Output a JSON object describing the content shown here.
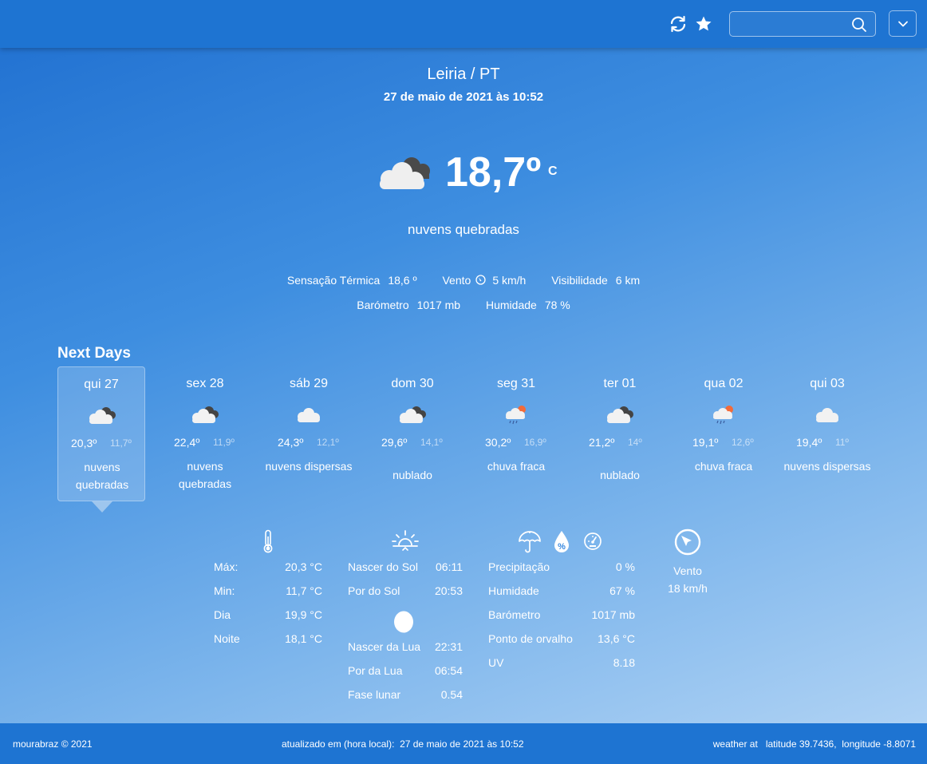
{
  "header": {
    "refresh_icon": "refresh-icon",
    "favorite_icon": "star-icon",
    "search": {
      "placeholder": "",
      "value": ""
    },
    "dropdown_icon": "chevron-down-icon"
  },
  "current": {
    "city": "Leiria / PT",
    "datetime": "27 de maio de 2021 às 10:52",
    "icon": "broken-clouds-icon",
    "temperature": "18,7º",
    "unit": "C",
    "condition": "nuvens quebradas",
    "stats": {
      "feels_like_label": "Sensação Térmica",
      "feels_like_value": "18,6 º",
      "wind_label": "Vento",
      "wind_value": "5 km/h",
      "visibility_label": "Visibilidade",
      "visibility_value": "6 km",
      "barometer_label": "Barómetro",
      "barometer_value": "1017 mb",
      "humidity_label": "Humidade",
      "humidity_value": "78 %"
    }
  },
  "next_days": {
    "title": "Next Days",
    "days": [
      {
        "name": "qui 27",
        "max": "20,3º",
        "min": "11,7º",
        "desc": "nuvens quebradas",
        "icon": "broken-clouds-icon"
      },
      {
        "name": "sex 28",
        "max": "22,4º",
        "min": "11,9º",
        "desc": "nuvens quebradas",
        "icon": "broken-clouds-icon"
      },
      {
        "name": "sáb 29",
        "max": "24,3º",
        "min": "12,1º",
        "desc": "nuvens dispersas",
        "icon": "scattered-clouds-icon"
      },
      {
        "name": "dom 30",
        "max": "29,6º",
        "min": "14,1º",
        "desc": "nublado",
        "icon": "overcast-clouds-icon"
      },
      {
        "name": "seg 31",
        "max": "30,2º",
        "min": "16,9º",
        "desc": "chuva fraca",
        "icon": "light-rain-icon"
      },
      {
        "name": "ter 01",
        "max": "21,2º",
        "min": "14º",
        "desc": "nublado",
        "icon": "overcast-clouds-icon"
      },
      {
        "name": "qua 02",
        "max": "19,1º",
        "min": "12,6º",
        "desc": "chuva fraca",
        "icon": "light-rain-icon"
      },
      {
        "name": "qui 03",
        "max": "19,4º",
        "min": "11º",
        "desc": "nuvens dispersas",
        "icon": "scattered-clouds-icon"
      }
    ]
  },
  "details": {
    "temperature": {
      "icon": "thermometer-icon",
      "rows": [
        {
          "label": "Máx:",
          "value": "20,3 °C"
        },
        {
          "label": "Min:",
          "value": "11,7 °C"
        },
        {
          "label": "Dia",
          "value": "19,9 °C"
        },
        {
          "label": "Noite",
          "value": "18,1 °C"
        }
      ]
    },
    "sun": {
      "icon": "sunrise-icon",
      "rows": [
        {
          "label": "Nascer do Sol",
          "value": "06:11"
        },
        {
          "label": "Por do Sol",
          "value": "20:53"
        }
      ]
    },
    "moon": {
      "icon": "moon-icon",
      "rows": [
        {
          "label": "Nascer da Lua",
          "value": "22:31"
        },
        {
          "label": "Por da Lua",
          "value": "06:54"
        },
        {
          "label": "Fase lunar",
          "value": "0.54"
        }
      ]
    },
    "atmosphere": {
      "icons": [
        "umbrella-icon",
        "humidity-icon",
        "gauge-icon"
      ],
      "rows": [
        {
          "label": "Precipitação",
          "value": "0 %"
        },
        {
          "label": "Humidade",
          "value": "67 %"
        },
        {
          "label": "Barómetro",
          "value": "1017 mb"
        },
        {
          "label": "Ponto de orvalho",
          "value": "13,6 °C"
        },
        {
          "label": "UV",
          "value": "8.18"
        }
      ]
    },
    "wind": {
      "icon": "wind-compass-icon",
      "label": "Vento",
      "value": "18 km/h"
    }
  },
  "footer": {
    "copyright": "mourabraz © 2021",
    "updated_label": "atualizado em (hora local):",
    "updated_value": "27 de maio de 2021 às 10:52",
    "weather_at": "weather at",
    "latitude": "latitude 39.7436,",
    "longitude": "longitude -8.8071"
  }
}
